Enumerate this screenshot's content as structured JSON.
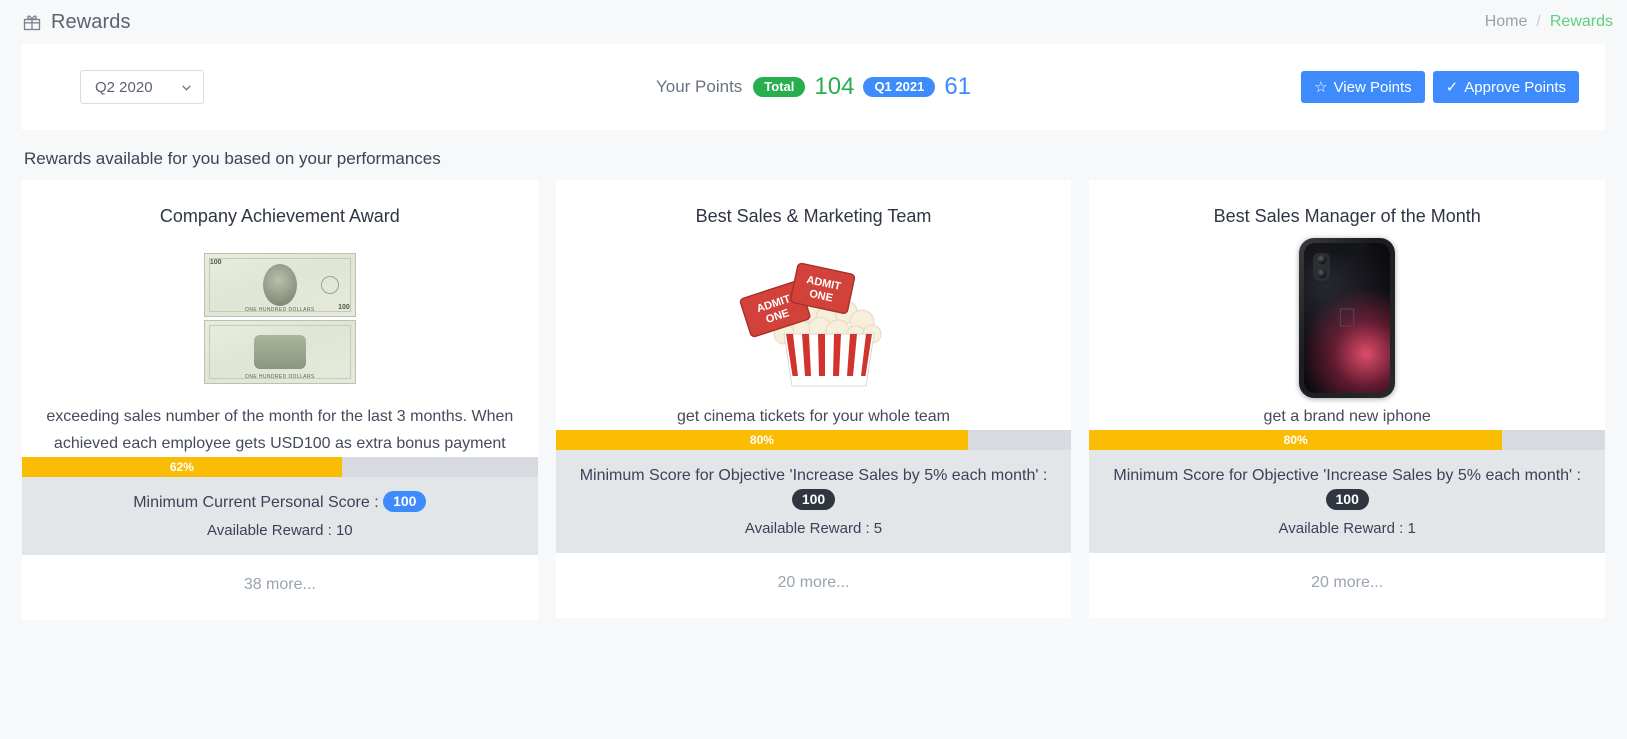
{
  "header": {
    "icon": "gift-icon",
    "title": "Rewards",
    "breadcrumb": {
      "home": "Home",
      "separator": "/",
      "current": "Rewards",
      "current_color": "#5fcf80"
    }
  },
  "toolbar": {
    "period_select": {
      "value": "Q2 2020",
      "icon": "chevron-down-icon"
    },
    "points": {
      "label": "Your Points",
      "total_badge": "Total",
      "total_value": "104",
      "total_color": "#27ae4d",
      "quarter_badge": "Q1 2021",
      "quarter_value": "61",
      "quarter_color": "#3d8bfd"
    },
    "view_points_button": {
      "icon": "star-icon",
      "glyph": "☆",
      "label": "View Points"
    },
    "approve_points_button": {
      "icon": "check-icon",
      "glyph": "✓",
      "label": "Approve Points"
    },
    "button_color": "#3d8bfd"
  },
  "section": {
    "title": "Rewards available for you based on your performances"
  },
  "cards": [
    {
      "title": "Company Achievement Award",
      "image": "hundred-dollar-bill-image",
      "description": "exceeding sales number of the month for the last 3 months. When achieved each employee gets USD100 as extra bonus payment",
      "progress_percent": 62,
      "progress_label": "62%",
      "progress_color": "#fbbc04",
      "score_prefix": "Minimum Current Personal Score :",
      "score_badge": "100",
      "score_badge_style": "blue",
      "reward_line": "Available Reward : 10",
      "more_label": "38 more..."
    },
    {
      "title": "Best Sales & Marketing Team",
      "image": "cinema-tickets-popcorn-image",
      "description": "get cinema tickets for your whole team",
      "progress_percent": 80,
      "progress_label": "80%",
      "progress_color": "#fbbc04",
      "score_prefix": "Minimum Score for Objective 'Increase Sales by 5% each month' :",
      "score_badge": "100",
      "score_badge_style": "dark",
      "reward_line": "Available Reward : 5",
      "more_label": "20 more..."
    },
    {
      "title": "Best Sales Manager of the Month",
      "image": "iphone-image",
      "description": "get a brand new iphone",
      "progress_percent": 80,
      "progress_label": "80%",
      "progress_color": "#fbbc04",
      "score_prefix": "Minimum Score for Objective 'Increase Sales by 5% each month' :",
      "score_badge": "100",
      "score_badge_style": "dark",
      "reward_line": "Available Reward : 1",
      "more_label": "20 more..."
    }
  ],
  "illustrations": {
    "bill_corner": "100",
    "bill_strip": "ONE HUNDRED DOLLARS",
    "ticket_word_top": "ADMIT",
    "ticket_word_bottom": "ONE",
    "apple_glyph": ""
  }
}
